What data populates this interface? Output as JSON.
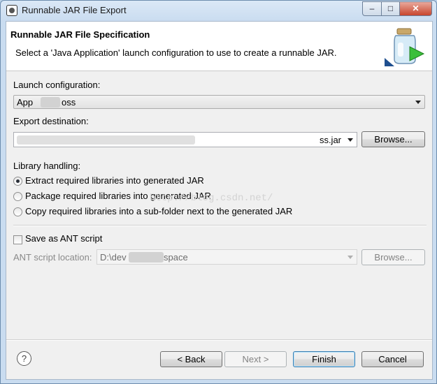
{
  "window": {
    "title": "Runnable JAR File Export",
    "controls": {
      "minimize": "–",
      "maximize": "□",
      "close": "✕"
    }
  },
  "header": {
    "title": "Runnable JAR File Specification",
    "description": "Select a 'Java Application' launch configuration to use to create a runnable JAR.",
    "icon": "jar-wizard-icon"
  },
  "launch": {
    "label": "Launch configuration:",
    "value_prefix": "App",
    "value_suffix": "oss"
  },
  "export": {
    "label": "Export destination:",
    "value_visible": "ss.jar",
    "browse_label": "Browse..."
  },
  "library": {
    "label": "Library handling:",
    "options": [
      {
        "label": "Extract required libraries into generated JAR",
        "selected": true
      },
      {
        "label": "Package required libraries into generated JAR",
        "selected": false
      },
      {
        "label": "Copy required libraries into a sub-folder next to the generated JAR",
        "selected": false
      }
    ]
  },
  "ant": {
    "checkbox_label": "Save as ANT script",
    "checked": false,
    "location_label": "ANT script location:",
    "location_prefix": "D:\\dev",
    "location_suffix": "space",
    "browse_label": "Browse..."
  },
  "watermark": "http://blog.csdn.net/",
  "footer": {
    "help": "?",
    "back": "< Back",
    "next": "Next >",
    "finish": "Finish",
    "cancel": "Cancel"
  },
  "colors": {
    "window_frame": "#c9dcf0",
    "close_button": "#c8462e",
    "dialog_bg": "#f0f0f0",
    "default_button_border": "#3c7fb1"
  }
}
